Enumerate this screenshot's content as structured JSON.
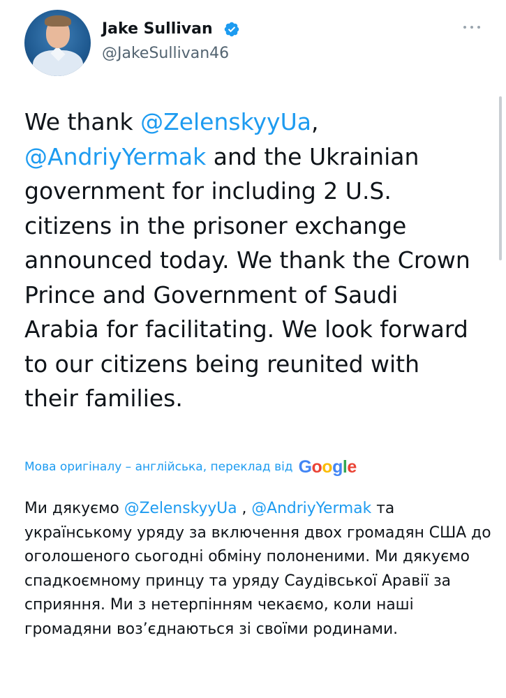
{
  "author": {
    "name": "Jake Sullivan",
    "handle": "@JakeSullivan46",
    "avatar_icon": "profile-photo-avatar",
    "verified_icon": "verified-badge-icon",
    "verified_color": "#1d9bf0"
  },
  "tweet": {
    "segments": [
      {
        "text": "We thank ",
        "type": "text"
      },
      {
        "text": "@ZelenskyyUa",
        "type": "mention"
      },
      {
        "text": ", ",
        "type": "text"
      },
      {
        "text": "@AndriyYermak",
        "type": "mention"
      },
      {
        "text": " and the Ukrainian government for including 2 U.S. citizens in the prisoner exchange announced today. We thank the Crown Prince and Government of Saudi Arabia for facilitating. We look forward to our citizens being reunited with their families.",
        "type": "text"
      }
    ]
  },
  "translation": {
    "note": "Мова оригіналу – англійська, переклад від",
    "provider": {
      "letters": [
        {
          "char": "G",
          "color": "#4285f4"
        },
        {
          "char": "o",
          "color": "#ea4335"
        },
        {
          "char": "o",
          "color": "#fbbc05"
        },
        {
          "char": "g",
          "color": "#4285f4"
        },
        {
          "char": "l",
          "color": "#34a853"
        },
        {
          "char": "e",
          "color": "#ea4335"
        }
      ]
    },
    "segments": [
      {
        "text": "Ми дякуємо ",
        "type": "text"
      },
      {
        "text": "@ZelenskyyUa",
        "type": "mention"
      },
      {
        "text": " , ",
        "type": "text"
      },
      {
        "text": "@AndriyYermak",
        "type": "mention"
      },
      {
        "text": " та українському уряду за включення двох громадян США до оголошеного сьогодні обміну полоненими. Ми дякуємо спадкоємному принцу та уряду Саудівської Аравії за сприяння. Ми з нетерпінням чекаємо, коли наші громадяни воз’єднаються зі своїми родинами.",
        "type": "text"
      }
    ]
  },
  "colors": {
    "link": "#1d9bf0",
    "text": "#0f1419",
    "secondary": "#536471"
  },
  "more_icon": "more-options-icon"
}
